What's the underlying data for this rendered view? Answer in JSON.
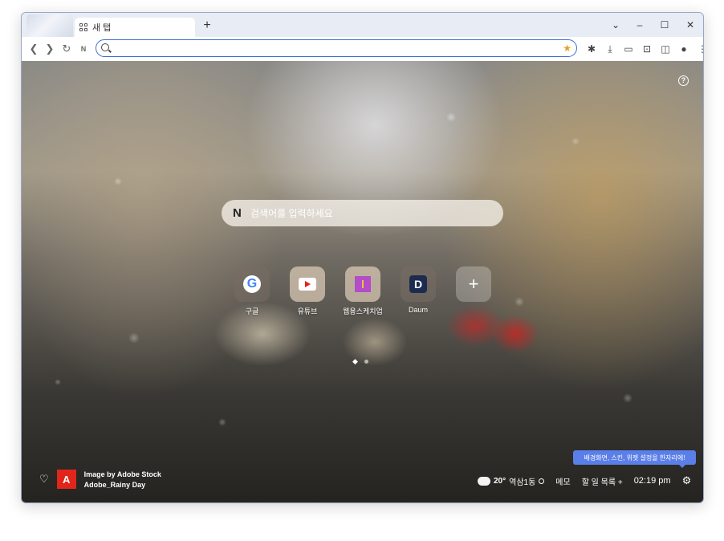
{
  "browser": {
    "tab_title": "새 탭",
    "new_tab_symbol": "+",
    "controls": {
      "dropdown": "⌄",
      "minimize": "–",
      "maximize": "☐",
      "close": "✕"
    },
    "omnibox_value": ""
  },
  "search": {
    "placeholder": "검색어를 입력하세요"
  },
  "shortcuts": [
    {
      "label": "구글",
      "icon": "google-icon"
    },
    {
      "label": "유튜브",
      "icon": "youtube-icon"
    },
    {
      "label": "웹용스케치업",
      "icon": "sketchup-web-icon"
    },
    {
      "label": "Daum",
      "icon": "daum-icon"
    },
    {
      "label": "",
      "icon": "plus-icon"
    }
  ],
  "credit": {
    "line1": "Image by Adobe Stock",
    "line2": "Adobe_Rainy Day"
  },
  "tooltip": "배경화면, 스킨, 위젯 설정을 한자리에!",
  "widgets": {
    "temperature": "20°",
    "location": "역삼1동",
    "memo": "메모",
    "todo": "할 일 목록 +",
    "time": "02:19 pm"
  },
  "colors": {
    "accent": "#5b7fe9",
    "omnibox_border": "#3b6fd4",
    "adobe_red": "#e1251b"
  }
}
